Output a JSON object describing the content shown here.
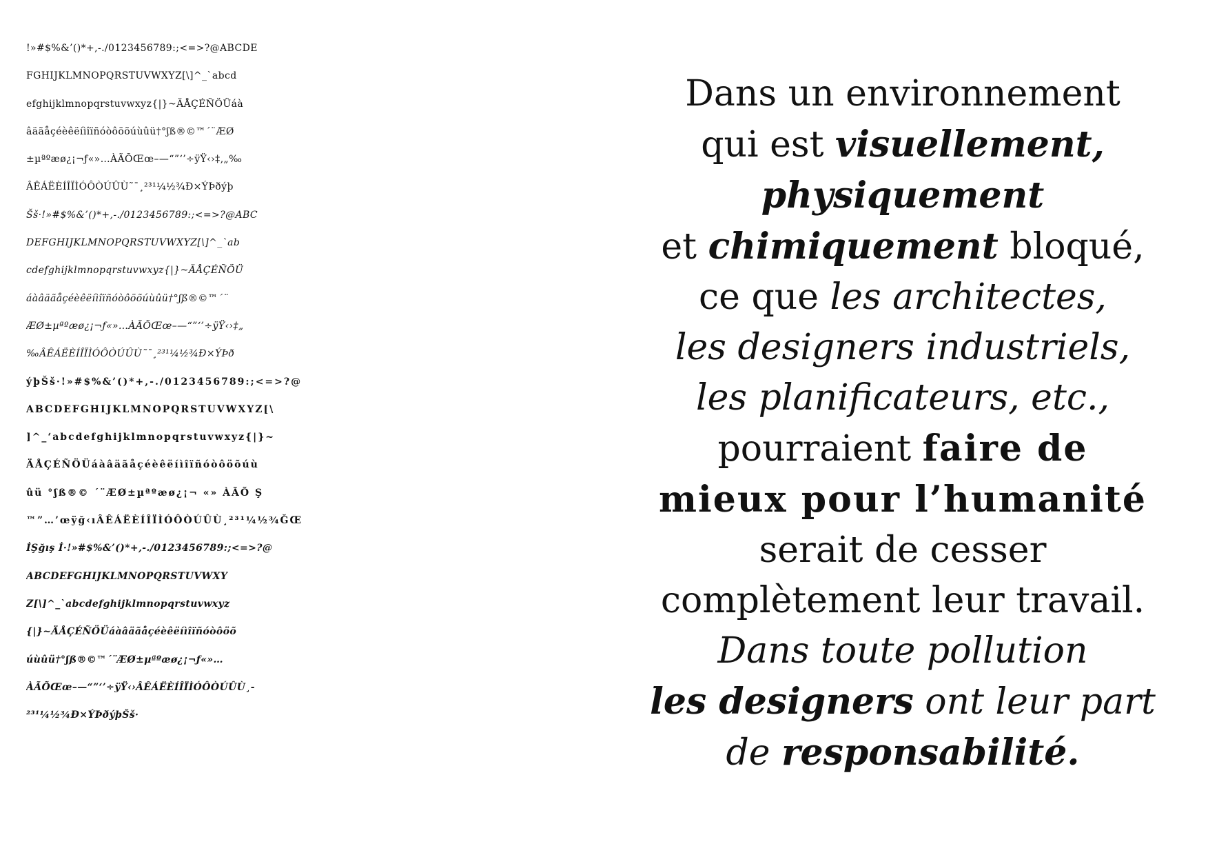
{
  "specimen": {
    "lines": [
      {
        "text": "!»#$%&’()*+,-./0123456789:;<=>?@ABCDE",
        "style": "regular"
      },
      {
        "text": "FGHIJKLMNOPQRSTUVWXYZ[\\]^_`abcd",
        "style": "regular"
      },
      {
        "text": "efghijklmnopqrstuvwxyz{|}~ÄÅÇÉÑÖÜáà",
        "style": "regular"
      },
      {
        "text": "âäãåçéèêëíìîïñóòôöõúùûü†°ʃß®©™´¨ÆØ",
        "style": "regular"
      },
      {
        "text": "±µªºæø¿¡¬ƒ«»…ÀÃÕŒœ–—“”‘’÷ÿŸ‹›‡‚„‰",
        "style": "regular"
      },
      {
        "text": "ÂÊÁËÈÍÎÏÌÓÔÒÚÛÙ˜¯¸²³¹¼½¾Ð×ÝÞðýþ",
        "style": "regular"
      },
      {
        "text": "Šš·!»#$%&’()*+,-./0123456789:;<=>?@ABC",
        "style": "italic"
      },
      {
        "text": "DEFGHIJKLMNOPQRSTUVWXYZ[\\]^_`ab",
        "style": "italic"
      },
      {
        "text": "cdefghijklmnopqrstuvwxyz{|}~ÄÅÇÉÑÖÜ",
        "style": "italic"
      },
      {
        "text": "áàâäãåçéèêëíìîïñóòôöõúùûü†°ʃß®©™´¨",
        "style": "italic"
      },
      {
        "text": "ÆØ±µªºæø¿¡¬ƒ«»…ÀÃÕŒœ–—“”‘’÷ÿŸ‹›‡„",
        "style": "italic"
      },
      {
        "text": "‰ÂÊÁËÈÍÎÏÌÓÔÒÚÛÙ˜¯¸²³¹¼½¾Ð×ÝÞð",
        "style": "italic"
      },
      {
        "text": "ýþŠš·!»#$%&’()*+,-./0123456789:;<=>?@",
        "style": "bold"
      },
      {
        "text": "ABCDEFGHIJKLMNOPQRSTUVWXYZ[\\",
        "style": "bold"
      },
      {
        "text": "]^_‘abcdefghijklmnopqrstuvwxyz{|}~",
        "style": "bold"
      },
      {
        "text": "ÄÅÇÉÑÖÜáàâäãåçéèêëíìîïñóòôöõúù",
        "style": "bold"
      },
      {
        "text": "ûü °ʃß®© ´¨ÆØ±µªºæø¿¡¬ «» ÀÃÕ Ş",
        "style": "bold"
      },
      {
        "text": "™”…’œÿğ‹ıÂÊÁËÈÍÎÏÌÓÔÒÚÛÙ¸²³¹¼½¾ĞŒ",
        "style": "bold"
      },
      {
        "text": "İŞğış İ·!»#$%&’()*+,-./0123456789:;<=>?@",
        "style": "bolditalic"
      },
      {
        "text": "ABCDEFGHIJKLMNOPQRSTUVWXY",
        "style": "bolditalic"
      },
      {
        "text": "Z[\\]^_`abcdefghijklmnopqrstuvwxyz",
        "style": "bolditalic"
      },
      {
        "text": "{|}~ÄÅÇÉÑÖÜáàâäãåçéèêëíìîïñóòôöõ",
        "style": "bolditalic"
      },
      {
        "text": "úùûü†°ʃß®©™´¨ÆØ±µªºæø¿¡¬ƒ«»…",
        "style": "bolditalic"
      },
      {
        "text": "ÀÃÕŒœ–—“”‘’÷ÿŸ‹›ÂÊÁËÈÍÎÏÌÓÔÒÚÛÙ¸-",
        "style": "bolditalic"
      },
      {
        "text": "²³¹¼½¾Ð×ÝÞðýþŠš·",
        "style": "bolditalic"
      }
    ]
  },
  "poem": {
    "lines": [
      [
        {
          "text": "Dans un environnement",
          "style": "regular"
        }
      ],
      [
        {
          "text": "qui est ",
          "style": "regular"
        },
        {
          "text": "visuellement,",
          "style": "bolditalic"
        }
      ],
      [
        {
          "text": "physiquement",
          "style": "bolditalic"
        }
      ],
      [
        {
          "text": "et ",
          "style": "regular"
        },
        {
          "text": "chimiquement",
          "style": "bolditalic"
        },
        {
          "text": " bloqué,",
          "style": "regular"
        }
      ],
      [
        {
          "text": "ce que ",
          "style": "regular"
        },
        {
          "text": "les architectes,",
          "style": "italic"
        }
      ],
      [
        {
          "text": "les designers industriels,",
          "style": "italic"
        }
      ],
      [
        {
          "text": "les planificateurs, etc.,",
          "style": "italic"
        }
      ],
      [
        {
          "text": "pourraient ",
          "style": "regular"
        },
        {
          "text": "faire de",
          "style": "heavy"
        }
      ],
      [
        {
          "text": "mieux pour l’humanité",
          "style": "heavy"
        }
      ],
      [
        {
          "text": "serait de cesser",
          "style": "regular"
        }
      ],
      [
        {
          "text": "complètement leur travail.",
          "style": "regular"
        }
      ],
      [
        {
          "text": "Dans toute pollution",
          "style": "italic"
        }
      ],
      [
        {
          "text": "les designers",
          "style": "bolditalic"
        },
        {
          "text": " ",
          "style": "regular"
        },
        {
          "text": "ont leur part",
          "style": "italic"
        }
      ],
      [
        {
          "text": "de ",
          "style": "italic"
        },
        {
          "text": "responsabilité.",
          "style": "bolditalic"
        }
      ]
    ]
  }
}
